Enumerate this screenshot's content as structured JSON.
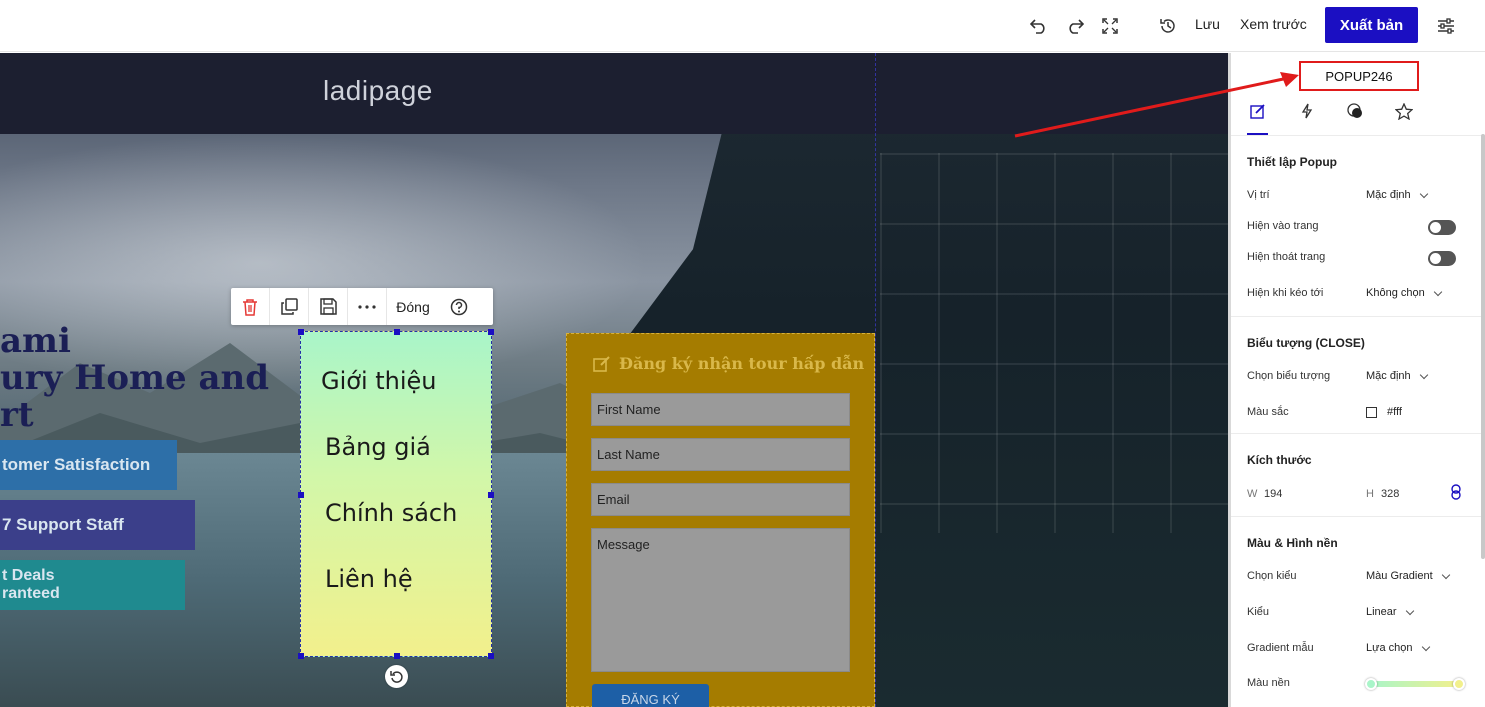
{
  "toolbar": {
    "undo_icon": "undo-icon",
    "redo_icon": "redo-icon",
    "fullscreen_icon": "fullscreen-icon",
    "history_icon": "history-icon",
    "save_label": "Lưu",
    "preview_label": "Xem trước",
    "publish_label": "Xuất bản",
    "settings_icon": "sliders-icon",
    "publish_color": "#1b0fc2"
  },
  "canvas": {
    "logo_text": "ladipage",
    "hero_title": "ami\nury Home and\nrt",
    "features": [
      {
        "label": "tomer Satisfaction",
        "color": "#2d6fa8"
      },
      {
        "label": "7 Support Staff",
        "color": "#3b3f8a"
      },
      {
        "label": "t Deals\nranteed",
        "color": "#1f8a8f"
      }
    ]
  },
  "element_toolbar": {
    "delete_icon": "trash-icon",
    "duplicate_icon": "copy-icon",
    "save_icon": "floppy-icon",
    "more_icon": "more-icon",
    "close_label": "Đóng",
    "help_icon": "help-icon"
  },
  "popup": {
    "menu_items": [
      "Giới thiệu",
      "Bảng giá",
      "Chính sách",
      "Liên hệ"
    ],
    "rotate_icon": "rotate-icon"
  },
  "form": {
    "title": "Đăng ký nhận tour hấp dẫn",
    "first_name_placeholder": "First Name",
    "last_name_placeholder": "Last Name",
    "email_placeholder": "Email",
    "message_placeholder": "Message",
    "submit_label": "ĐĂNG KÝ",
    "background_color": "#a57c00"
  },
  "panel": {
    "popup_id": "POPUP246",
    "tabs": [
      {
        "name": "edit-icon",
        "active": true
      },
      {
        "name": "lightning-icon",
        "active": false
      },
      {
        "name": "palette-icon",
        "active": false
      },
      {
        "name": "star-icon",
        "active": false
      }
    ],
    "popup_settings": {
      "title": "Thiết lập Popup",
      "position_label": "Vị trí",
      "position_value": "Mặc định",
      "show_on_enter_label": "Hiện vào trang",
      "show_on_exit_label": "Hiện thoát trang",
      "show_on_scroll_label": "Hiện khi kéo tới",
      "show_on_scroll_value": "Không chọn"
    },
    "close_icon_settings": {
      "title": "Biểu tượng (CLOSE)",
      "choose_icon_label": "Chọn biểu tượng",
      "choose_icon_value": "Mặc định",
      "color_label": "Màu sắc",
      "color_value": "#fff"
    },
    "size": {
      "title": "Kích thước",
      "w_label": "W",
      "w_value": "194",
      "h_label": "H",
      "h_value": "328",
      "link_icon": "link-icon"
    },
    "background": {
      "title": "Màu & Hình nền",
      "type_label": "Chọn kiểu",
      "type_value": "Màu Gradient",
      "style_label": "Kiểu",
      "style_value": "Linear",
      "gradient_label": "Gradient mẫu",
      "gradient_value": "Lựa chọn",
      "bg_color_label": "Màu nền",
      "gradient_start": "#a9f5c9",
      "gradient_end": "#f2f08c"
    }
  }
}
